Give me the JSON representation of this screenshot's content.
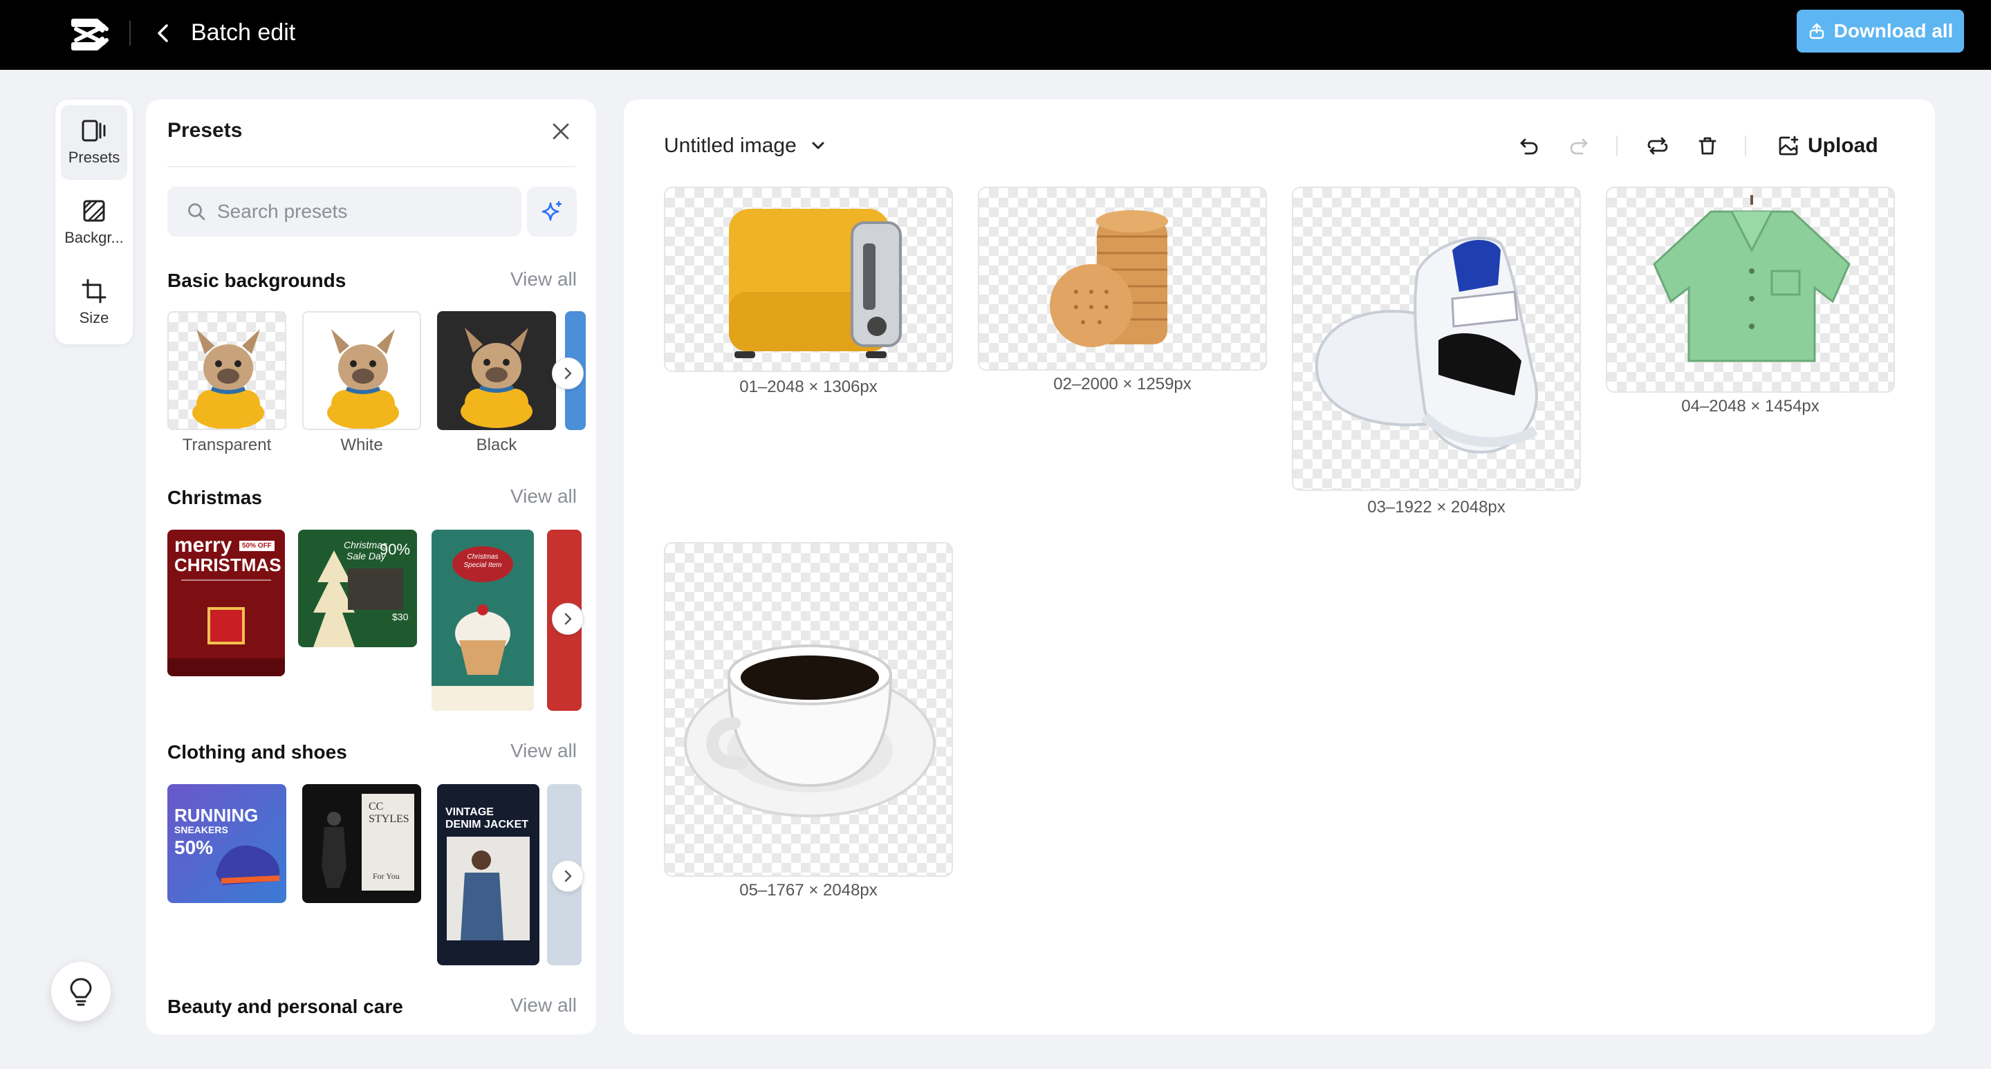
{
  "topbar": {
    "title": "Batch edit",
    "download_label": "Download all"
  },
  "rail": {
    "items": [
      {
        "label": "Presets",
        "icon": "presets-icon",
        "active": true
      },
      {
        "label": "Backgr...",
        "icon": "background-icon"
      },
      {
        "label": "Size",
        "icon": "crop-icon"
      }
    ]
  },
  "presets": {
    "title": "Presets",
    "search_placeholder": "Search presets",
    "view_all": "View all",
    "sections": [
      {
        "title": "Basic backgrounds",
        "items": [
          "Transparent",
          "White",
          "Black"
        ]
      },
      {
        "title": "Christmas"
      },
      {
        "title": "Clothing and shoes"
      },
      {
        "title": "Beauty and personal care"
      }
    ],
    "christmas_thumbs": {
      "t1_line1": "merry",
      "t1_badge": "50% OFF",
      "t1_line2": "CHRISTMAS",
      "t2_line1": "Christmas",
      "t2_line2": "Sale Day",
      "t2_pct": "90%",
      "t2_price": "$30",
      "t3_title": "Christmas Special Item"
    },
    "clothing_thumbs": {
      "t1_line1": "RUNNING",
      "t1_line2": "SNEAKERS",
      "t1_pct": "50%",
      "t2_line1": "CC",
      "t2_line2": "STYLES",
      "t2_sub": "For You",
      "t3_line1": "VINTAGE",
      "t3_line2": "DENIM JACKET"
    }
  },
  "workspace": {
    "doc_title": "Untitled image",
    "upload_label": "Upload",
    "images": [
      {
        "caption": "01–2048 × 1306px",
        "subject": "toaster"
      },
      {
        "caption": "02–2000 × 1259px",
        "subject": "crackers"
      },
      {
        "caption": "03–1922 × 2048px",
        "subject": "sneaker"
      },
      {
        "caption": "04–2048 × 1454px",
        "subject": "shirt"
      },
      {
        "caption": "05–1767 × 2048px",
        "subject": "coffee-cup"
      }
    ]
  },
  "colors": {
    "topbar": "#000000",
    "accent": "#5db5f2",
    "canvas_bg": "#f0f2f5"
  }
}
